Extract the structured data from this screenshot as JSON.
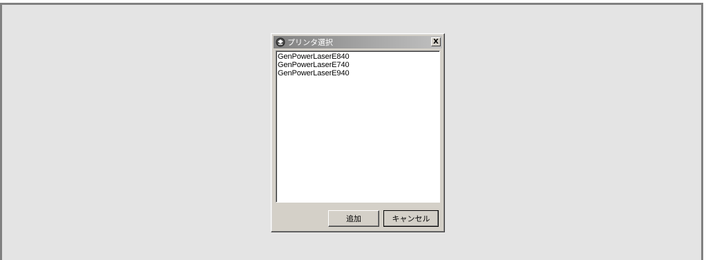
{
  "dialog": {
    "title": "プリンタ選択",
    "title_icon": "printer-icon",
    "close_label": "X"
  },
  "printers": [
    {
      "label": "GenPowerLaserE840"
    },
    {
      "label": "GenPowerLaserE740"
    },
    {
      "label": "GenPowerLaserE940"
    }
  ],
  "buttons": {
    "add_label": "追加",
    "cancel_label": "キャンセル"
  },
  "colors": {
    "workspace_bg": "#e4e4e4",
    "dialog_face": "#d4d0c8",
    "titlebar_inactive": "#808080"
  }
}
